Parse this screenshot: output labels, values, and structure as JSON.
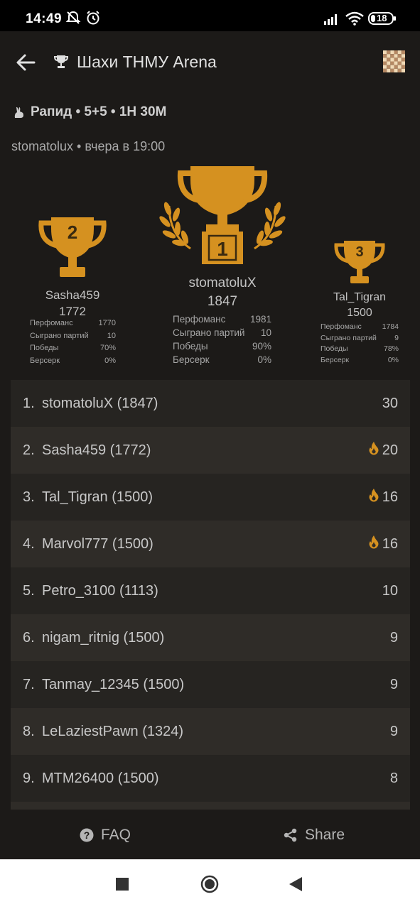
{
  "status_bar": {
    "time": "14:49",
    "battery": "18"
  },
  "header": {
    "title": "Шахи ТНМУ Arena"
  },
  "tournament": {
    "info": "Рапид • 5+5 • 1Н 30М",
    "meta": "stomatolux • вчера в 19:00"
  },
  "podium": {
    "first": {
      "rank": "1",
      "name": "stomatoluX",
      "rating": "1847",
      "stats": [
        {
          "label": "Перфоманс",
          "value": "1981"
        },
        {
          "label": "Сыграно партий",
          "value": "10"
        },
        {
          "label": "Победы",
          "value": "90%"
        },
        {
          "label": "Берсерк",
          "value": "0%"
        }
      ]
    },
    "second": {
      "rank": "2",
      "name": "Sasha459",
      "rating": "1772",
      "stats": [
        {
          "label": "Перфоманс",
          "value": "1770"
        },
        {
          "label": "Сыграно партий",
          "value": "10"
        },
        {
          "label": "Победы",
          "value": "70%"
        },
        {
          "label": "Берсерк",
          "value": "0%"
        }
      ]
    },
    "third": {
      "rank": "3",
      "name": "Tal_Tigran",
      "rating": "1500",
      "stats": [
        {
          "label": "Перфоманс",
          "value": "1784"
        },
        {
          "label": "Сыграно партий",
          "value": "9"
        },
        {
          "label": "Победы",
          "value": "78%"
        },
        {
          "label": "Берсерк",
          "value": "0%"
        }
      ]
    }
  },
  "standings": [
    {
      "rank": "1.",
      "player": "stomatoluX (1847)",
      "score": "30",
      "fire": false
    },
    {
      "rank": "2.",
      "player": "Sasha459 (1772)",
      "score": "20",
      "fire": true
    },
    {
      "rank": "3.",
      "player": "Tal_Tigran (1500)",
      "score": "16",
      "fire": true
    },
    {
      "rank": "4.",
      "player": "Marvol777 (1500)",
      "score": "16",
      "fire": true
    },
    {
      "rank": "5.",
      "player": "Petro_3100 (1113)",
      "score": "10",
      "fire": false
    },
    {
      "rank": "6.",
      "player": "nigam_ritnig (1500)",
      "score": "9",
      "fire": false
    },
    {
      "rank": "7.",
      "player": "Tanmay_12345 (1500)",
      "score": "9",
      "fire": false
    },
    {
      "rank": "8.",
      "player": "LeLaziestPawn (1324)",
      "score": "9",
      "fire": false
    },
    {
      "rank": "9.",
      "player": "MTM26400 (1500)",
      "score": "8",
      "fire": false
    },
    {
      "rank": "",
      "player": "",
      "score": "",
      "fire": false
    }
  ],
  "bottom": {
    "faq": "FAQ",
    "share": "Share"
  },
  "colors": {
    "accent": "#d59120",
    "background": "#1c1a18",
    "row_odd": "#262421",
    "row_even": "#2f2c28"
  }
}
